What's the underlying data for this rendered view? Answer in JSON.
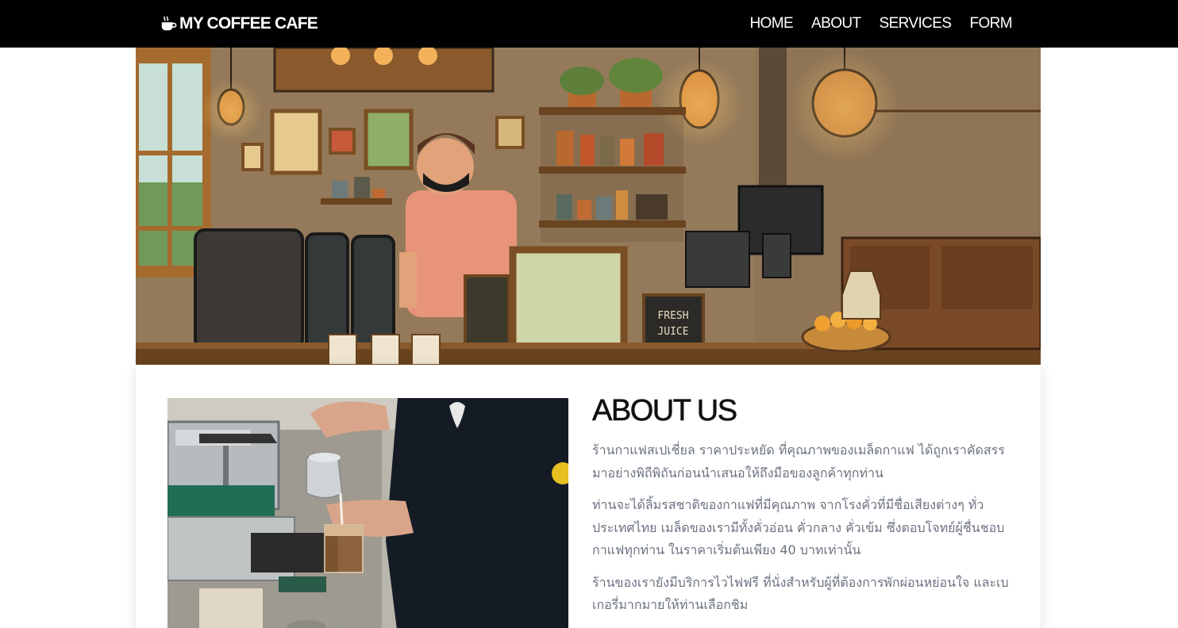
{
  "navbar": {
    "brand": "MY COFFEE CAFE",
    "brand_icon": "coffee-cup-icon",
    "links": [
      "HOME",
      "ABOUT",
      "SERVICES",
      "FORM"
    ]
  },
  "hero": {
    "sign_text": "FRESH JUICE"
  },
  "about": {
    "title": "ABOUT US",
    "paragraphs": [
      "ร้านกาแฟสเปเชี่ยล ราคาประหยัด ที่คุณภาพของเมล็ดกาแฟ ได้ถูกเราคัดสรรมาอย่างพิถีพิถันก่อนนำเสนอให้ถึงมือของลูกค้าทุกท่าน",
      "ท่านจะได้ลิ้มรสชาติของกาแฟที่มีคุณภาพ จากโรงคั่วที่มีชื่อเสียงต่างๆ ทั่วประเทศไทย เมล็ดของเรามีทั้งคั่วอ่อน คั่วกลาง คั่วเข้ม ซึ่งตอบโจทย์ผู้ชื่นชอบกาแฟทุกท่าน ในราคาเริ่มต้นเพียง 40 บาทเท่านั้น",
      "ร้านของเรายังมีบริการไวไฟฟรี ที่นั่งสำหรับผู้ที่ต้องการพักผ่อนหย่อนใจ และเบเกอรี่มากมายให้ท่านเลือกชิม"
    ]
  },
  "colors": {
    "navbar_bg": "#000000",
    "text_muted": "#6b7280"
  }
}
